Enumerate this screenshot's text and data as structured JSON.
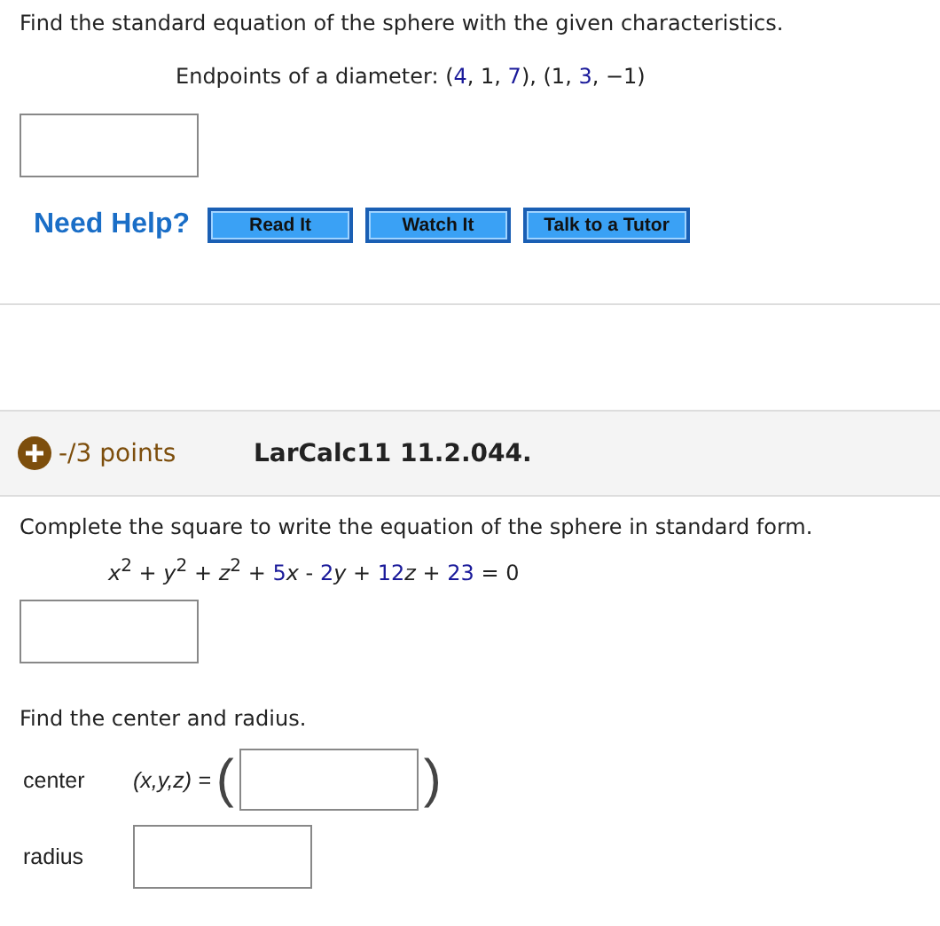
{
  "question1": {
    "prompt": "Find the standard equation of the sphere with the given characteristics.",
    "given": [
      {
        "text": "Endpoints of a diameter: (",
        "kind": "plain"
      },
      {
        "text": "4",
        "kind": "given"
      },
      {
        "text": ", 1, ",
        "kind": "plain"
      },
      {
        "text": "7",
        "kind": "given"
      },
      {
        "text": "), (1, ",
        "kind": "plain"
      },
      {
        "text": "3",
        "kind": "given"
      },
      {
        "text": ", −1)",
        "kind": "plain"
      }
    ],
    "help_label": "Need Help?",
    "help_buttons": [
      "Read It",
      "Watch It",
      "Talk to a Tutor"
    ]
  },
  "question2": {
    "points": "-/3 points",
    "code": "LarCalc11 11.2.044.",
    "prompt": "Complete the square to write the equation of the sphere in standard form.",
    "equation": [
      {
        "text": "*x*$^{2}$ + *y*$^{2}$ + *z*$^{2}$ + ",
        "kind": "plain"
      },
      {
        "text": "5",
        "kind": "given"
      },
      {
        "text": "*x* - ",
        "kind": "plain"
      },
      {
        "text": "2",
        "kind": "given"
      },
      {
        "text": "*y* + ",
        "kind": "plain"
      },
      {
        "text": "12",
        "kind": "given"
      },
      {
        "text": "*z* + ",
        "kind": "plain"
      },
      {
        "text": "23",
        "kind": "given"
      },
      {
        "text": " = 0",
        "kind": "plain"
      }
    ],
    "sub_prompt": "Find the center and radius.",
    "center_label": "center",
    "center_expr": "(x,y,z) =",
    "open_paren": "(",
    "close_paren": ")",
    "radius_label": "radius"
  }
}
